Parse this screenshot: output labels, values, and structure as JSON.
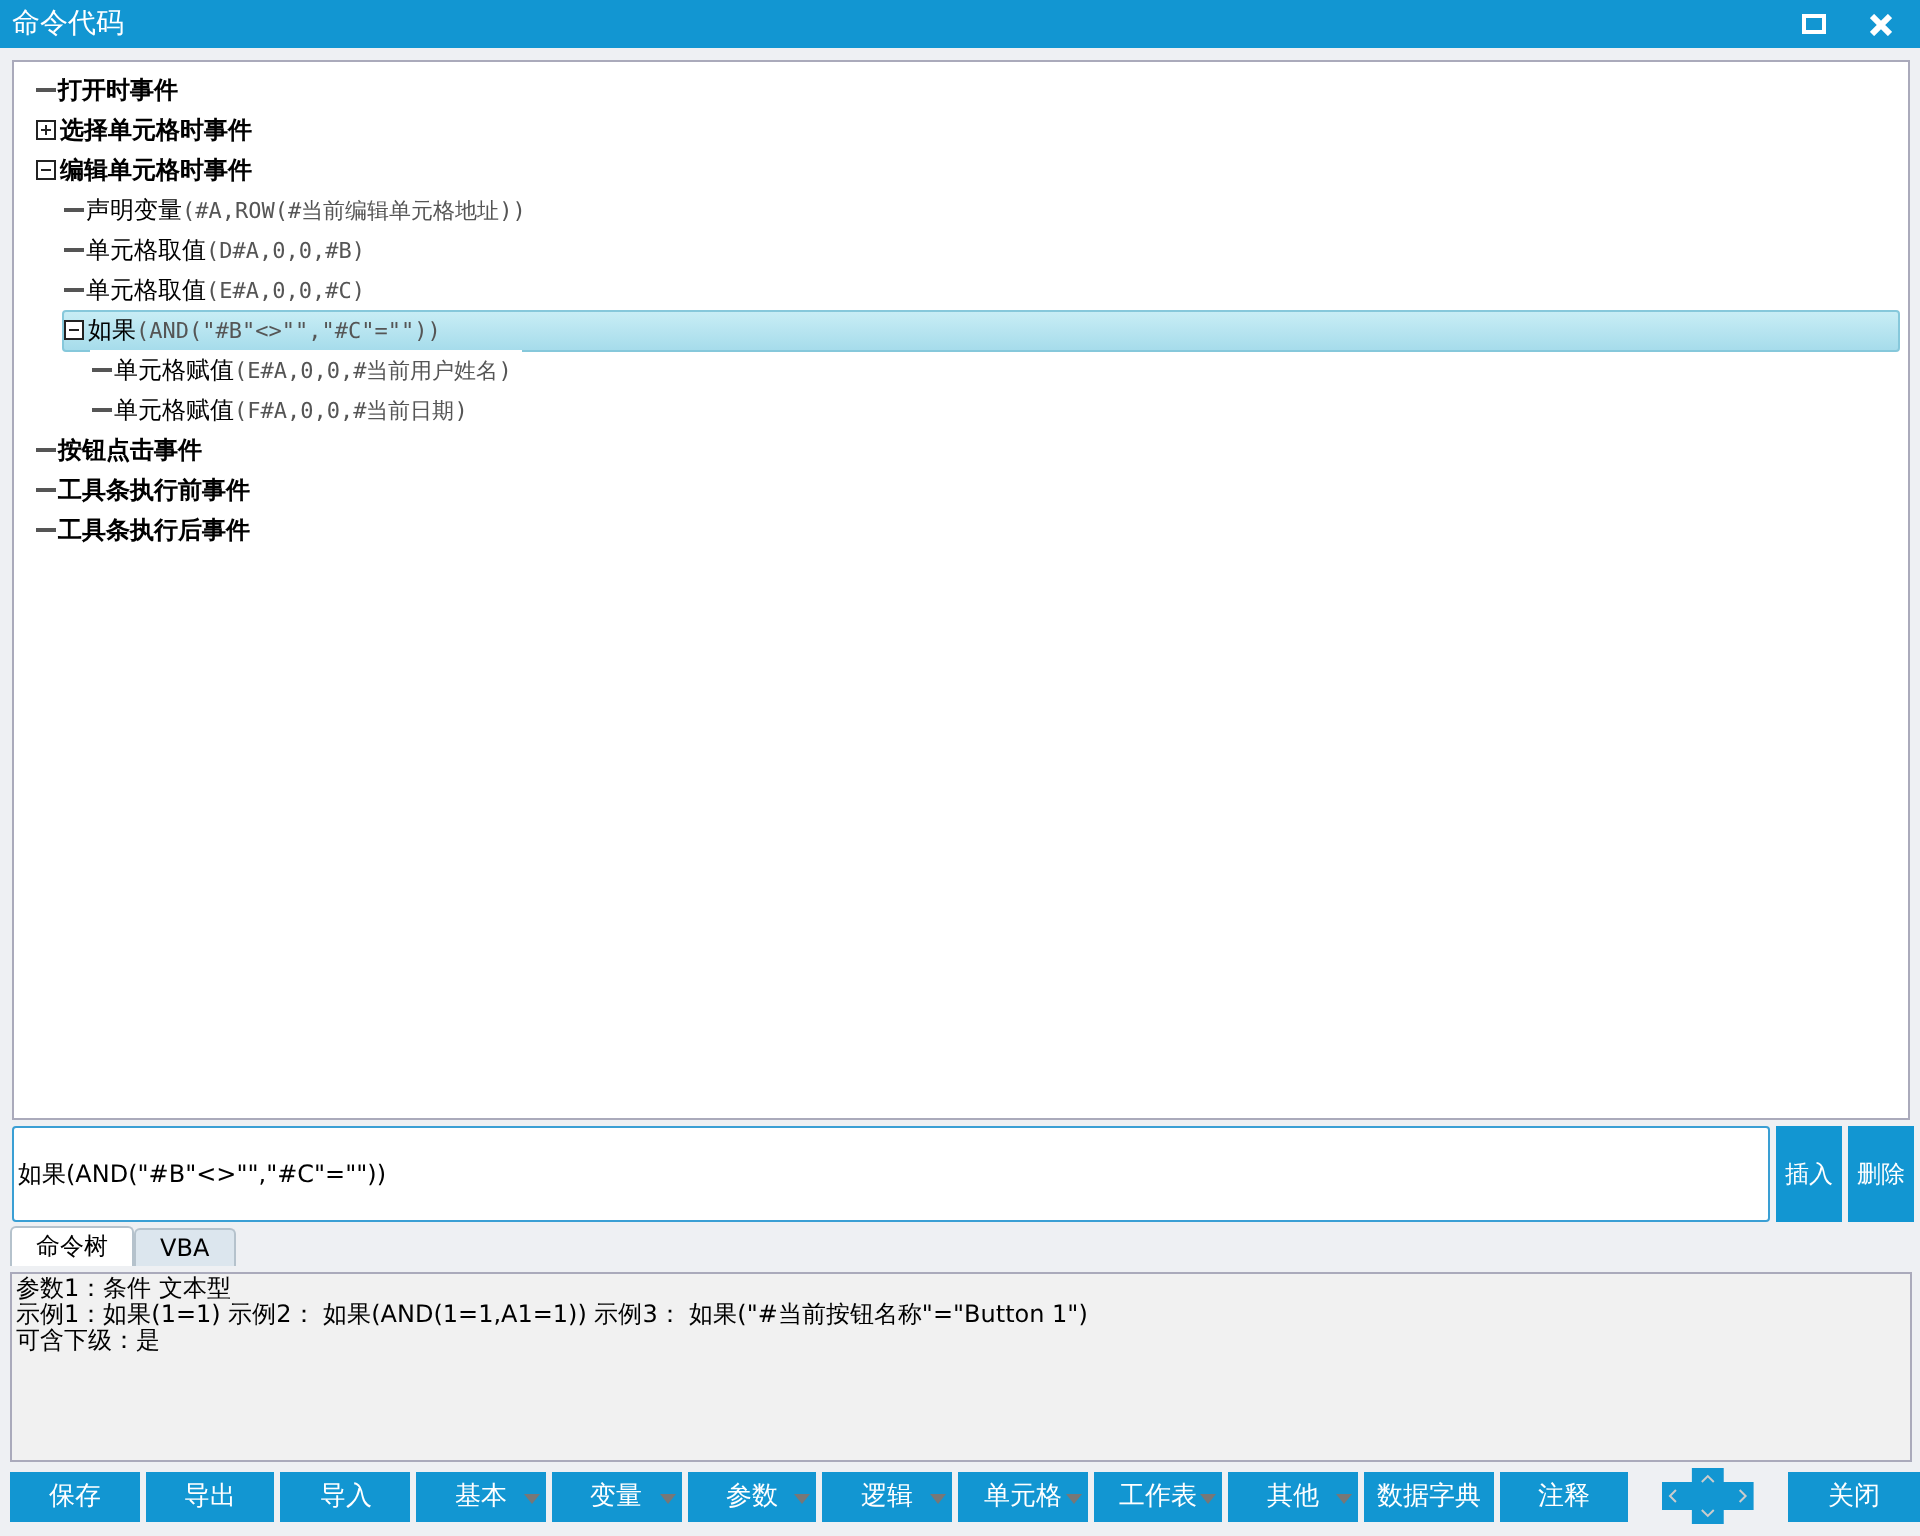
{
  "window": {
    "title": "命令代码"
  },
  "tree": [
    {
      "label": "打开时事件",
      "selected": false
    },
    {
      "label": "选择单元格时事件",
      "expanded": false,
      "selected": false
    },
    {
      "label": "编辑单元格时事件",
      "expanded": true,
      "selected": false,
      "children": [
        {
          "label": "声明变量",
          "args": "(#A,ROW(#当前编辑单元格地址))",
          "selected": false
        },
        {
          "label": "单元格取值",
          "args": "(D#A,0,0,#B)",
          "selected": false
        },
        {
          "label": "单元格取值",
          "args": "(E#A,0,0,#C)",
          "selected": false
        },
        {
          "label": "如果",
          "args": "(AND(\"#B\"<>\"\",\"#C\"=\"\"))",
          "expanded": true,
          "selected": true,
          "children": [
            {
              "label": "单元格赋值",
              "args": "(E#A,0,0,#当前用户姓名)",
              "selected": false
            },
            {
              "label": "单元格赋值",
              "args": "(F#A,0,0,#当前日期)",
              "selected": false
            }
          ]
        }
      ]
    },
    {
      "label": "按钮点击事件",
      "selected": false
    },
    {
      "label": "工具条执行前事件",
      "selected": false
    },
    {
      "label": "工具条执行后事件",
      "selected": false
    }
  ],
  "command_input": {
    "value": "如果(AND(\"#B\"<>\"\",\"#C\"=\"\"))"
  },
  "side_buttons": [
    "插入",
    "删除"
  ],
  "tabs": [
    {
      "label": "命令树",
      "selected": true
    },
    {
      "label": "VBA",
      "selected": false
    }
  ],
  "help_lines": [
    "参数1：条件 文本型",
    "示例1：如果(1=1) 示例2： 如果(AND(1=1,A1=1)) 示例3： 如果(\"#当前按钮名称\"=\"Button 1\")",
    "可含下级：是"
  ],
  "toolbar": [
    {
      "label": "保存",
      "has_menu": false
    },
    {
      "label": "导出",
      "has_menu": false
    },
    {
      "label": "导入",
      "has_menu": false
    },
    {
      "label": "基本",
      "has_menu": true
    },
    {
      "label": "变量",
      "has_menu": true
    },
    {
      "label": "参数",
      "has_menu": true
    },
    {
      "label": "逻辑",
      "has_menu": true
    },
    {
      "label": "单元格",
      "has_menu": true
    },
    {
      "label": "工作表",
      "has_menu": true
    },
    {
      "label": "其他",
      "has_menu": true
    },
    {
      "label": "数据字典",
      "has_menu": false
    },
    {
      "label": "注释",
      "has_menu": false
    }
  ],
  "close_button": "关闭"
}
